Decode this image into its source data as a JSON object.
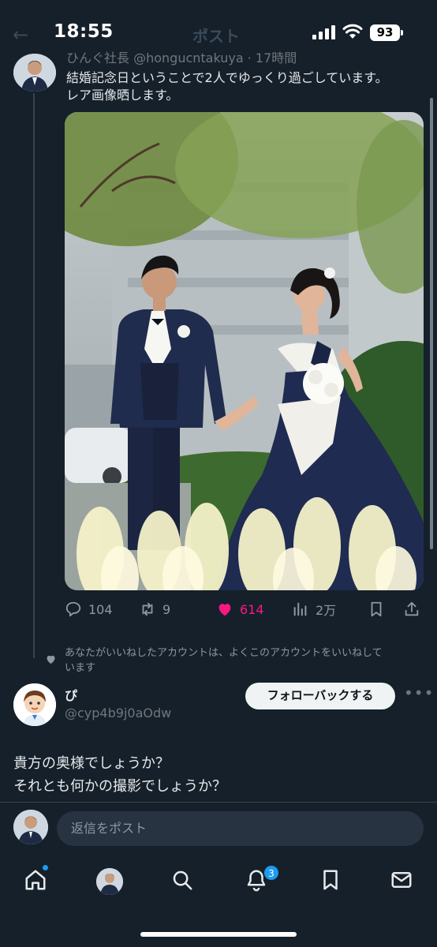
{
  "status_bar": {
    "time": "18:55",
    "battery": "93",
    "icons": [
      "signal-icon",
      "wifi-icon",
      "battery-icon"
    ]
  },
  "header": {
    "back_glyph": "←",
    "title": "ポスト"
  },
  "tweet": {
    "author_line": "ひんぐ社長 @hongucntakuya · 17時間",
    "text_lines": [
      "結婚記念日ということで2人でゆっくり過ごしています。",
      "レア画像晒します。"
    ],
    "stats": {
      "replies": "104",
      "retweets": "9",
      "likes": "614",
      "views": "2万"
    },
    "like_color": "#f91880"
  },
  "liked_notice": {
    "lines": [
      "あなたがいいねしたアカウントは、よくこのアカウントをいいねして",
      "います"
    ]
  },
  "reply": {
    "name": "ぴ",
    "handle": "@cyp4b9j0aOdw",
    "follow_label": "フォローバックする",
    "more": "•••",
    "text_lines": [
      "貴方の奥様でしょうか？",
      "それとも何かの撮影でしょうか？"
    ]
  },
  "composer": {
    "placeholder": "返信をポスト"
  },
  "tab_bar": {
    "items": [
      "home-icon",
      "profile-avatar",
      "search-icon",
      "notifications-icon",
      "bookmarks-icon",
      "messages-icon"
    ],
    "notification_count": "3",
    "accent": "#1d9bf0"
  },
  "theme": {
    "background": "#15202b",
    "text": "#e7e9ea",
    "muted": "#8b98a5"
  }
}
